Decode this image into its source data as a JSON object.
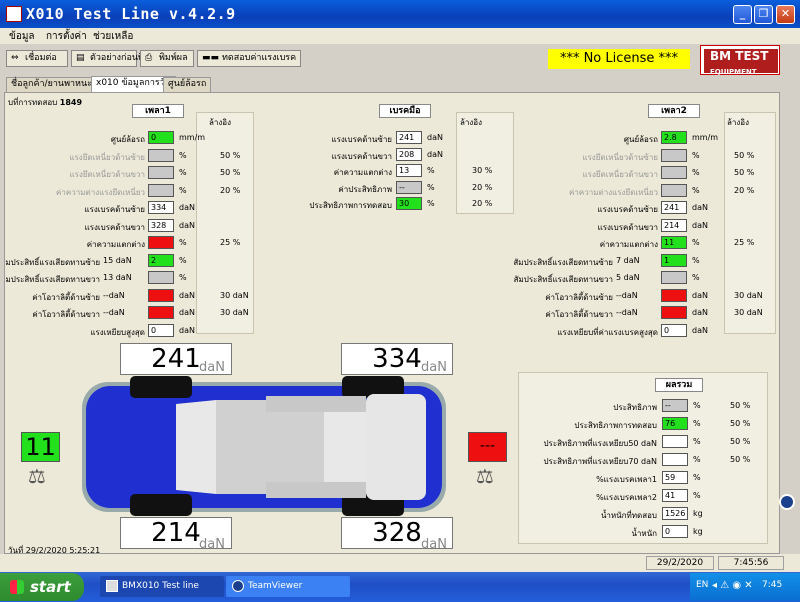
{
  "window": {
    "title": "X010 Test Line v.4.2.9"
  },
  "menu": [
    "ข้อมูล",
    "การตั้งค่า",
    "ช่วยเหลือ"
  ],
  "toolbar": {
    "btn1": "เชื่อมต่อ",
    "btn2": "ตัวอย่างก่อนพิมพ์",
    "btn3": "พิมพ์ผล",
    "btn4": "ทดสอบค่าแรงเบรค"
  },
  "license": "***  No License  ***",
  "logo": {
    "line1": "BM TEST",
    "line2": "EQUIPMENT"
  },
  "tabs": [
    "ชื่อลูกค้า/ยานพาหนะ",
    "x010 ข้อมูลการวัด",
    "ศูนย์ล้อรถ"
  ],
  "test_no_label": "บที่การทดสอบ",
  "test_no": "1849",
  "axle1": {
    "title": "เพลา1",
    "side_note": "ล้างอิง",
    "rows": [
      {
        "label": "ศูนย์ล้อรถ",
        "value": "0",
        "unit": "mm/m",
        "ref": "",
        "dim": false,
        "color": "g"
      },
      {
        "label": "แรงยึดเหนี่ยวด้านซ้าย",
        "value": "",
        "unit": "%",
        "ref": "50 %",
        "dim": true,
        "color": "gr"
      },
      {
        "label": "แรงยึดเหนี่ยวด้านขวา",
        "value": "",
        "unit": "%",
        "ref": "50 %",
        "dim": true,
        "color": "gr"
      },
      {
        "label": "ค่าความต่างแรงยึดเหนี่ยว",
        "value": "",
        "unit": "%",
        "ref": "20 %",
        "dim": true,
        "color": "gr"
      },
      {
        "label": "แรงเบรคด้านซ้าย",
        "value": "334",
        "unit": "daN",
        "ref": "",
        "dim": false,
        "color": ""
      },
      {
        "label": "แรงเบรคด้านขวา",
        "value": "328",
        "unit": "daN",
        "ref": "",
        "dim": false,
        "color": ""
      },
      {
        "label": "ค่าความแตกต่าง",
        "value": "",
        "unit": "%",
        "ref": "25 %",
        "dim": false,
        "color": "r"
      },
      {
        "label": "มประสิทธิ์แรงเสียดทานซ้าย",
        "pre": "15 daN",
        "value": "2",
        "unit": "%",
        "ref": "",
        "dim": false,
        "color": "g"
      },
      {
        "label": "มประสิทธิ์แรงเสียดทานขวา",
        "pre": "13 daN",
        "value": "",
        "unit": "%",
        "ref": "",
        "dim": false,
        "color": "gr"
      },
      {
        "label": "ค่าโอวาลิตี้ด้านซ้าย",
        "pre": "--daN",
        "value": "",
        "unit": "daN",
        "ref": "30 daN",
        "dim": false,
        "color": "r"
      },
      {
        "label": "ค่าโอวาลิตี้ด้านขวา",
        "pre": "--daN",
        "value": "",
        "unit": "daN",
        "ref": "30 daN",
        "dim": false,
        "color": "r"
      },
      {
        "label": "แรงเหยียบสูงสุด",
        "value": "0",
        "unit": "daN",
        "ref": "",
        "dim": false,
        "color": ""
      }
    ]
  },
  "handbrake": {
    "title": "เบรคมือ",
    "side_note": "ล้างอิง",
    "rows": [
      {
        "label": "แรงเบรคด้านซ้าย",
        "value": "241",
        "unit": "daN",
        "ref": "",
        "color": ""
      },
      {
        "label": "แรงเบรคด้านขวา",
        "value": "208",
        "unit": "daN",
        "ref": "",
        "color": ""
      },
      {
        "label": "ค่าความแตกต่าง",
        "value": "13",
        "unit": "%",
        "ref": "30 %",
        "color": ""
      },
      {
        "label": "ค่าประสิทธิภาพ",
        "value": "--",
        "unit": "%",
        "ref": "20 %",
        "color": "gr"
      },
      {
        "label": "ประสิทธิภาพการทดสอบ",
        "value": "30",
        "unit": "%",
        "ref": "20 %",
        "color": "g"
      }
    ]
  },
  "axle2": {
    "title": "เพลา2",
    "side_note": "ล้างอิง",
    "rows": [
      {
        "label": "ศูนย์ล้อรถ",
        "value": "2.8",
        "unit": "mm/m",
        "ref": "",
        "dim": false,
        "color": "g"
      },
      {
        "label": "แรงยึดเหนี่ยวด้านซ้าย",
        "value": "",
        "unit": "%",
        "ref": "50 %",
        "dim": true,
        "color": "gr"
      },
      {
        "label": "แรงยึดเหนี่ยวด้านขวา",
        "value": "",
        "unit": "%",
        "ref": "50 %",
        "dim": true,
        "color": "gr"
      },
      {
        "label": "ค่าความต่างแรงยึดเหนี่ยว",
        "value": "",
        "unit": "%",
        "ref": "20 %",
        "dim": true,
        "color": "gr"
      },
      {
        "label": "แรงเบรคด้านซ้าย",
        "value": "241",
        "unit": "daN",
        "ref": "",
        "dim": false,
        "color": ""
      },
      {
        "label": "แรงเบรคด้านขวา",
        "value": "214",
        "unit": "daN",
        "ref": "",
        "dim": false,
        "color": ""
      },
      {
        "label": "ค่าความแตกต่าง",
        "value": "11",
        "unit": "%",
        "ref": "25 %",
        "dim": false,
        "color": "g"
      },
      {
        "label": "สัมประสิทธิ์แรงเสียดทานซ้าย",
        "pre": "7 daN",
        "value": "1",
        "unit": "%",
        "ref": "",
        "dim": false,
        "color": "g"
      },
      {
        "label": "สัมประสิทธิ์แรงเสียดทานขวา",
        "pre": "5 daN",
        "value": "",
        "unit": "%",
        "ref": "",
        "dim": false,
        "color": "gr"
      },
      {
        "label": "ค่าโอวาลิตี้ด้านซ้าย",
        "pre": "--daN",
        "value": "",
        "unit": "daN",
        "ref": "30 daN",
        "dim": false,
        "color": "r"
      },
      {
        "label": "ค่าโอวาลิตี้ด้านขวา",
        "pre": "--daN",
        "value": "",
        "unit": "daN",
        "ref": "30 daN",
        "dim": false,
        "color": "r"
      },
      {
        "label": "แรงเหยียบที่ค่าแรงเบรคสูงสุด",
        "value": "0",
        "unit": "daN",
        "ref": "",
        "dim": false,
        "color": ""
      }
    ]
  },
  "summary": {
    "title": "ผลรวม",
    "rows": [
      {
        "label": "ประสิทธิภาพ",
        "value": "--",
        "unit": "%",
        "ref": "50 %",
        "color": "gr"
      },
      {
        "label": "ประสิทธิภาพการทดสอบ",
        "value": "76",
        "unit": "%",
        "ref": "50 %",
        "color": "g"
      },
      {
        "label": "ประสิทธิภาพที่แรงเหยียบ50 daN",
        "value": "",
        "unit": "%",
        "ref": "50 %",
        "color": ""
      },
      {
        "label": "ประสิทธิภาพที่แรงเหยียบ70 daN",
        "value": "",
        "unit": "%",
        "ref": "50 %",
        "color": ""
      },
      {
        "label": "%แรงเบรคเพลา1",
        "value": "59",
        "unit": "%",
        "ref": "",
        "color": ""
      },
      {
        "label": "%แรงเบรคเพลา2",
        "value": "41",
        "unit": "%",
        "ref": "",
        "color": ""
      },
      {
        "label": "น้ำหนักที่ทดสอบ",
        "value": "1526",
        "unit": "kg",
        "ref": "",
        "color": ""
      },
      {
        "label": "น้ำหนัก",
        "value": "0",
        "unit": "kg",
        "ref": "",
        "color": ""
      }
    ]
  },
  "car": {
    "front_left": "241",
    "front_right": "334",
    "rear_left": "214",
    "rear_right": "328",
    "unit": "daN",
    "left_indicator": "11",
    "right_indicator": "---",
    "left_color": "#22e01c",
    "right_color": "#ee1010",
    "body_color": "#1f2fd0"
  },
  "status": {
    "date_label": "วันที่",
    "datetime": "29/2/2020 5:25:21",
    "date": "29/2/2020",
    "time": "7:45:56"
  },
  "taskbar": {
    "start": "start",
    "task1": "BMX010 Test line",
    "task2": "TeamViewer",
    "tray_lang": "EN",
    "tray_time": "7:45"
  }
}
